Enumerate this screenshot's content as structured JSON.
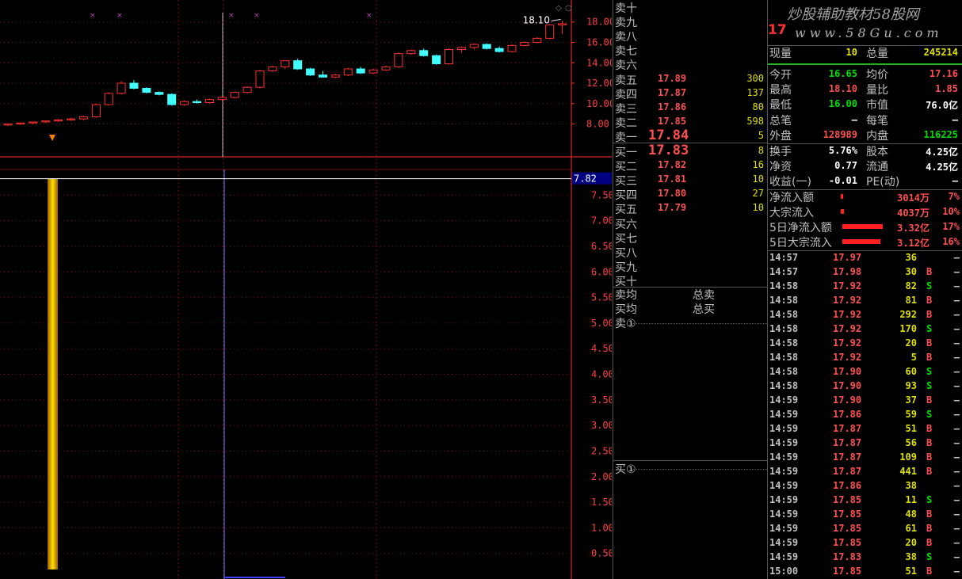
{
  "chart": {
    "price_ticks": [
      "18.00",
      "16.00",
      "14.00",
      "12.00",
      "10.00",
      "8.00"
    ],
    "price_min": 6.8,
    "price_max": 18.6,
    "high_label": "18.10",
    "lower_ticks": [
      "7.50",
      "7.00",
      "6.50",
      "6.00",
      "5.50",
      "5.00",
      "4.50",
      "4.00",
      "3.50",
      "3.00",
      "2.50",
      "2.00",
      "1.50",
      "1.00",
      "0.50"
    ],
    "lower_max": 8.0,
    "current_value": "7.82",
    "indicator_value": 7.82,
    "colors": {
      "up": "#ff3030",
      "down": "#40ffff",
      "axis": "#ff3030",
      "grid": "#7a1010",
      "bar_gold": "#ffc000"
    }
  },
  "chart_data": {
    "type": "candlestick",
    "ohlc": [
      [
        7.9,
        8.0,
        7.8,
        8.0
      ],
      [
        8.0,
        8.1,
        7.9,
        8.1
      ],
      [
        8.1,
        8.2,
        8.0,
        8.2
      ],
      [
        8.2,
        8.3,
        8.1,
        8.3
      ],
      [
        8.3,
        8.5,
        8.2,
        8.4
      ],
      [
        8.4,
        8.6,
        8.3,
        8.5
      ],
      [
        8.5,
        8.8,
        8.4,
        8.7
      ],
      [
        8.7,
        10.0,
        8.6,
        9.9
      ],
      [
        9.9,
        11.1,
        9.8,
        11.0
      ],
      [
        11.0,
        12.2,
        10.9,
        12.0
      ],
      [
        12.0,
        12.3,
        11.4,
        11.5
      ],
      [
        11.5,
        11.6,
        11.0,
        11.1
      ],
      [
        11.1,
        11.2,
        10.8,
        10.9
      ],
      [
        10.9,
        11.0,
        9.8,
        9.9
      ],
      [
        9.9,
        10.3,
        9.8,
        10.2
      ],
      [
        10.2,
        10.4,
        10.0,
        10.1
      ],
      [
        10.1,
        10.5,
        10.0,
        10.4
      ],
      [
        10.4,
        10.7,
        10.3,
        10.6
      ],
      [
        10.6,
        11.2,
        10.5,
        11.1
      ],
      [
        11.1,
        11.7,
        11.0,
        11.6
      ],
      [
        11.6,
        13.3,
        11.5,
        13.2
      ],
      [
        13.2,
        13.7,
        13.1,
        13.6
      ],
      [
        13.6,
        14.2,
        13.4,
        14.2
      ],
      [
        14.2,
        14.4,
        13.3,
        13.4
      ],
      [
        13.4,
        13.5,
        12.7,
        12.8
      ],
      [
        12.8,
        13.2,
        12.6,
        12.6
      ],
      [
        12.6,
        12.9,
        12.5,
        12.8
      ],
      [
        12.8,
        13.5,
        12.7,
        13.4
      ],
      [
        13.4,
        13.6,
        12.9,
        13.0
      ],
      [
        13.0,
        13.4,
        12.9,
        13.3
      ],
      [
        13.3,
        13.7,
        13.2,
        13.6
      ],
      [
        13.6,
        15.0,
        13.5,
        14.9
      ],
      [
        14.9,
        15.3,
        14.8,
        15.2
      ],
      [
        15.2,
        15.4,
        14.6,
        14.7
      ],
      [
        14.7,
        14.8,
        13.8,
        13.9
      ],
      [
        13.9,
        15.4,
        13.8,
        15.3
      ],
      [
        15.3,
        15.6,
        15.0,
        15.5
      ],
      [
        15.5,
        15.9,
        15.3,
        15.8
      ],
      [
        15.8,
        15.9,
        15.3,
        15.4
      ],
      [
        15.4,
        15.6,
        15.0,
        15.1
      ],
      [
        15.1,
        15.8,
        15.0,
        15.7
      ],
      [
        15.7,
        16.1,
        15.6,
        16.0
      ],
      [
        16.0,
        16.5,
        15.9,
        16.4
      ],
      [
        16.4,
        17.8,
        16.3,
        17.7
      ],
      [
        17.7,
        18.1,
        16.8,
        17.83
      ]
    ]
  },
  "orderbook": {
    "sell_labels": [
      "卖十",
      "卖九",
      "卖八",
      "卖七",
      "卖六",
      "卖五",
      "卖四",
      "卖三",
      "卖二",
      "卖一"
    ],
    "sell_prices": [
      "",
      "",
      "",
      "",
      "",
      "17.89",
      "17.87",
      "17.86",
      "17.85",
      "17.84"
    ],
    "sell_vols": [
      "",
      "",
      "",
      "",
      "",
      "300",
      "137",
      "80",
      "598",
      "5"
    ],
    "buy_labels": [
      "买一",
      "买二",
      "买三",
      "买四",
      "买五",
      "买六",
      "买七",
      "买八",
      "买九",
      "买十"
    ],
    "buy_prices": [
      "17.83",
      "17.82",
      "17.81",
      "17.80",
      "17.79",
      "",
      "",
      "",
      "",
      ""
    ],
    "buy_vols": [
      "8",
      "16",
      "10",
      "27",
      "10",
      "",
      "",
      "",
      "",
      ""
    ],
    "sell_avg_label": "卖均",
    "buy_avg_label": "买均",
    "total_sell_label": "总卖",
    "total_buy_label": "总买",
    "sell_queue_label": "卖①",
    "buy_queue_label": "买①"
  },
  "stats": {
    "watermark": "炒股辅助教材58股网",
    "watermark_url": "www.58Gu.com",
    "code_partial": "17",
    "now_vol_label": "现量",
    "now_vol": "10",
    "total_vol_label": "总量",
    "total_vol": "245214",
    "open_label": "今开",
    "open": "16.65",
    "avg_label": "均价",
    "avg": "17.16",
    "high_label": "最高",
    "high": "18.10",
    "vol_ratio_label": "量比",
    "vol_ratio": "1.85",
    "low_label": "最低",
    "low": "16.00",
    "mktcap_label": "市值",
    "mktcap": "76.0亿",
    "total_trades_label": "总笔",
    "total_trades": "–",
    "per_trade_label": "每笔",
    "per_trade": "–",
    "outer_label": "外盘",
    "outer": "128989",
    "inner_label": "内盘",
    "inner": "116225",
    "turnover_label": "换手",
    "turnover": "5.76%",
    "shares_label": "股本",
    "shares": "4.25亿",
    "nav_label": "净资",
    "nav": "0.77",
    "float_label": "流通",
    "float": "4.25亿",
    "eps_label": "收益(一)",
    "eps": "-0.01",
    "pe_label": "PE(动)",
    "pe": "–",
    "flows": [
      {
        "label": "净流入额",
        "value": "3014万",
        "pct": "7%",
        "ratio": 0.07
      },
      {
        "label": "大宗流入",
        "value": "4037万",
        "pct": "10%",
        "ratio": 0.1
      },
      {
        "label": "5日净流入额",
        "value": "3.32亿",
        "pct": "17%",
        "ratio": 0.17
      },
      {
        "label": "5日大宗流入",
        "value": "3.12亿",
        "pct": "16%",
        "ratio": 0.16
      }
    ]
  },
  "trades": [
    [
      "14:57",
      "17.97",
      "36",
      ""
    ],
    [
      "14:57",
      "17.98",
      "30",
      "B"
    ],
    [
      "14:58",
      "17.92",
      "82",
      "S"
    ],
    [
      "14:58",
      "17.92",
      "81",
      "B"
    ],
    [
      "14:58",
      "17.92",
      "292",
      "B"
    ],
    [
      "14:58",
      "17.92",
      "170",
      "S"
    ],
    [
      "14:58",
      "17.92",
      "20",
      "B"
    ],
    [
      "14:58",
      "17.92",
      "5",
      "B"
    ],
    [
      "14:58",
      "17.90",
      "60",
      "S"
    ],
    [
      "14:58",
      "17.90",
      "93",
      "S"
    ],
    [
      "14:59",
      "17.90",
      "37",
      "B"
    ],
    [
      "14:59",
      "17.86",
      "59",
      "S"
    ],
    [
      "14:59",
      "17.87",
      "51",
      "B"
    ],
    [
      "14:59",
      "17.87",
      "56",
      "B"
    ],
    [
      "14:59",
      "17.87",
      "109",
      "B"
    ],
    [
      "14:59",
      "17.87",
      "441",
      "B"
    ],
    [
      "14:59",
      "17.86",
      "38",
      ""
    ],
    [
      "14:59",
      "17.85",
      "11",
      "S"
    ],
    [
      "14:59",
      "17.85",
      "48",
      "B"
    ],
    [
      "14:59",
      "17.85",
      "61",
      "B"
    ],
    [
      "14:59",
      "17.85",
      "20",
      "B"
    ],
    [
      "14:59",
      "17.83",
      "38",
      "S"
    ],
    [
      "15:00",
      "17.85",
      "51",
      "B"
    ]
  ]
}
